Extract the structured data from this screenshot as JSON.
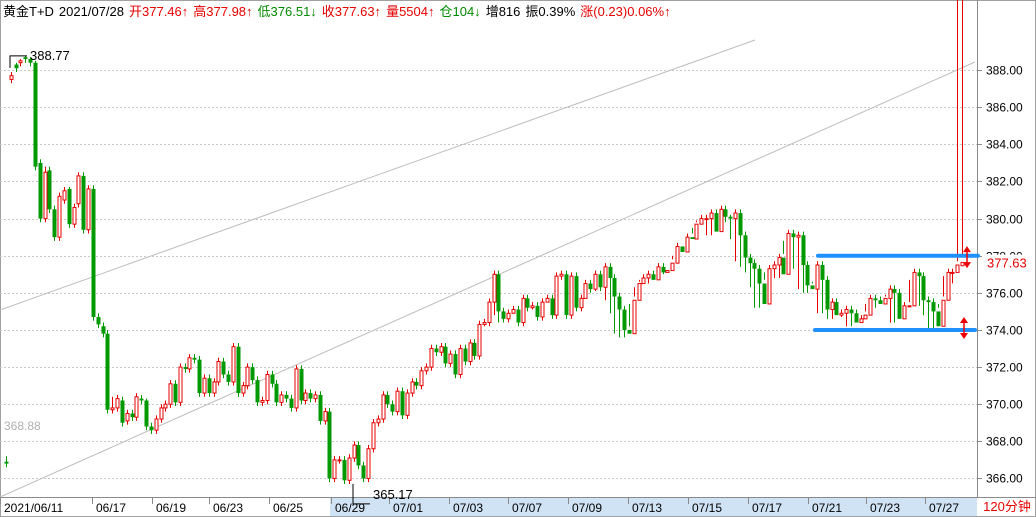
{
  "header": {
    "symbol": "黄金T+D",
    "date": "2021/07/28",
    "open": "开377.46↑",
    "high": "高377.98↑",
    "low": "低376.51↓",
    "close": "收377.63↑",
    "volume": "量5504↑",
    "position": "仓104↓",
    "increase": "增816",
    "amplitude": "振0.39%",
    "change": "涨(0.23)0.06%↑"
  },
  "timeframe": "120分钟",
  "colors": {
    "up": "#e60000",
    "down": "#009900",
    "support_lines": "#1e90ff",
    "arrows": "#ee0000"
  },
  "chart_data": {
    "type": "candlestick",
    "ylim": [
      365.0,
      390.0
    ],
    "y_ticks": [
      "366.00",
      "368.00",
      "370.00",
      "372.00",
      "374.00",
      "376.00",
      "378.00",
      "380.00",
      "382.00",
      "384.00",
      "386.00",
      "388.00"
    ],
    "x_labels": [
      "2021/06/11",
      "06/17",
      "06/19",
      "06/23",
      "06/25",
      "06/29",
      "07/01",
      "07/03",
      "07/07",
      "07/09",
      "07/13",
      "07/15",
      "07/17",
      "07/21",
      "07/23",
      "07/27"
    ],
    "annotations": {
      "high_label": "388.77",
      "low_label": "365.17",
      "left_ref": "368.88",
      "last_price": "377.63"
    },
    "range_lines": [
      378.0,
      374.0
    ],
    "closes": [
      366.8,
      387.7,
      388.1,
      388.5,
      388.6,
      388.4,
      382.8,
      380.0,
      382.5,
      380.5,
      379.0,
      381.2,
      381.5,
      379.7,
      380.6,
      382.3,
      379.4,
      381.6,
      374.7,
      374.3,
      373.8,
      369.7,
      369.8,
      370.3,
      369.0,
      369.5,
      369.3,
      370.4,
      370.2,
      368.8,
      368.6,
      369.2,
      369.8,
      370.0,
      371.1,
      370.1,
      372.0,
      371.9,
      372.5,
      372.4,
      370.6,
      371.4,
      370.6,
      371.2,
      372.3,
      371.6,
      371.2,
      373.1,
      370.6,
      371.0,
      372.0,
      371.3,
      370.1,
      370.2,
      371.6,
      371.1,
      370.1,
      370.5,
      370.3,
      369.8,
      371.9,
      370.2,
      370.6,
      370.3,
      370.5,
      369.1,
      369.6,
      366.0,
      367.0,
      367.0,
      365.9,
      367.1,
      367.8,
      366.7,
      366.0,
      367.6,
      369.0,
      369.2,
      370.5,
      370.0,
      369.6,
      370.7,
      369.4,
      370.6,
      371.2,
      371.0,
      371.8,
      372.0,
      373.0,
      372.8,
      373.1,
      372.2,
      372.7,
      371.6,
      373.0,
      372.3,
      373.3,
      372.6,
      374.3,
      374.4,
      375.5,
      377.0,
      375.0,
      374.6,
      374.9,
      375.1,
      374.4,
      375.7,
      375.2,
      375.3,
      374.7,
      375.5,
      375.7,
      374.8,
      376.9,
      377.0,
      374.8,
      376.9,
      375.2,
      375.7,
      376.5,
      376.2,
      377.0,
      376.3,
      377.4,
      376.8,
      375.8,
      375.1,
      374.0,
      373.8,
      375.6,
      376.5,
      376.8,
      377.0,
      376.7,
      377.4,
      377.1,
      377.2,
      377.6,
      378.5,
      378.2,
      379.0,
      378.9,
      379.7,
      380.0,
      380.0,
      380.3,
      379.3,
      380.5,
      380.1,
      380.0,
      380.3,
      379.1,
      377.9,
      377.6,
      377.3,
      376.5,
      375.4,
      377.3,
      377.5,
      377.9,
      377.0,
      379.2,
      379.0,
      379.1,
      377.5,
      376.4,
      376.2,
      377.5,
      376.7,
      375.1,
      375.5,
      374.8,
      374.9,
      375.1,
      374.9,
      374.4,
      374.6,
      374.8,
      375.7,
      375.6,
      375.4,
      375.7,
      376.2,
      376.0,
      374.6,
      375.3,
      375.3,
      377.1,
      376.9,
      375.6,
      375.5,
      375.0,
      374.2,
      375.6,
      377.1,
      377.1,
      377.5,
      377.63
    ],
    "opens": [
      366.9,
      387.5,
      388.3,
      388.4,
      388.7,
      388.6,
      388.4,
      383.0,
      380.0,
      382.6,
      380.5,
      379.0,
      381.0,
      381.6,
      379.7,
      380.8,
      382.3,
      379.4,
      381.6,
      374.7,
      374.2,
      373.8,
      369.7,
      369.8,
      370.2,
      369.1,
      369.5,
      369.3,
      370.3,
      370.2,
      368.8,
      368.6,
      369.2,
      369.8,
      370.0,
      371.1,
      370.1,
      372.0,
      371.9,
      372.5,
      372.4,
      370.6,
      371.4,
      370.6,
      371.2,
      372.3,
      371.6,
      371.2,
      373.1,
      370.6,
      371.0,
      372.0,
      371.3,
      370.1,
      370.2,
      371.6,
      371.1,
      370.1,
      370.5,
      370.3,
      369.8,
      371.9,
      370.2,
      370.6,
      370.3,
      370.5,
      369.1,
      369.6,
      366.0,
      367.0,
      367.0,
      365.9,
      367.1,
      367.8,
      366.7,
      366.0,
      367.6,
      369.0,
      369.2,
      370.5,
      370.0,
      369.6,
      370.7,
      369.4,
      370.6,
      371.2,
      371.0,
      371.8,
      372.0,
      373.0,
      372.8,
      373.1,
      372.2,
      372.7,
      371.6,
      373.0,
      372.3,
      373.3,
      372.6,
      374.3,
      374.4,
      375.5,
      377.0,
      375.0,
      374.6,
      374.9,
      375.1,
      374.4,
      375.7,
      375.2,
      375.3,
      374.7,
      375.5,
      375.7,
      374.8,
      376.9,
      377.0,
      374.8,
      376.9,
      375.2,
      375.7,
      376.5,
      376.2,
      377.0,
      376.3,
      377.4,
      376.8,
      375.8,
      375.1,
      374.0,
      373.8,
      375.6,
      376.5,
      376.8,
      377.0,
      376.7,
      377.4,
      377.1,
      377.2,
      377.6,
      378.5,
      378.2,
      379.0,
      378.9,
      379.7,
      380.0,
      380.0,
      380.3,
      379.3,
      380.5,
      380.1,
      380.0,
      380.3,
      379.1,
      377.9,
      377.6,
      377.3,
      376.5,
      375.4,
      377.3,
      377.5,
      377.9,
      377.0,
      379.2,
      379.0,
      379.1,
      377.5,
      376.4,
      376.2,
      377.5,
      376.7,
      375.1,
      375.5,
      374.8,
      374.9,
      375.1,
      374.9,
      374.4,
      374.6,
      374.8,
      375.7,
      375.6,
      375.4,
      375.7,
      376.2,
      376.0,
      374.6,
      375.3,
      375.3,
      377.1,
      376.9,
      375.6,
      375.5,
      375.0,
      374.2,
      375.6,
      377.1,
      377.1,
      377.46
    ],
    "highs": [
      367.2,
      387.9,
      388.4,
      388.6,
      388.77,
      388.7,
      388.5,
      383.2,
      382.8,
      382.8,
      380.7,
      381.4,
      381.7,
      381.7,
      380.8,
      382.5,
      382.5,
      381.8,
      381.8,
      374.9,
      374.4,
      374.0,
      370.4,
      370.5,
      370.4,
      369.7,
      369.7,
      370.6,
      370.5,
      370.3,
      369.0,
      369.4,
      370.0,
      370.2,
      371.3,
      371.3,
      372.2,
      372.2,
      372.7,
      372.7,
      372.6,
      371.6,
      371.6,
      371.4,
      372.5,
      372.5,
      371.8,
      373.3,
      373.3,
      371.2,
      372.2,
      372.2,
      371.5,
      370.4,
      371.8,
      371.8,
      371.3,
      370.7,
      370.7,
      370.5,
      372.1,
      372.1,
      370.8,
      370.8,
      370.7,
      370.7,
      369.8,
      369.8,
      367.2,
      367.2,
      367.2,
      367.3,
      368.0,
      368.0,
      366.9,
      367.8,
      369.2,
      369.4,
      370.7,
      370.7,
      370.2,
      370.9,
      370.9,
      370.8,
      371.4,
      371.4,
      372.0,
      372.2,
      373.2,
      373.2,
      373.3,
      373.3,
      372.9,
      372.9,
      373.2,
      373.2,
      373.5,
      373.5,
      374.5,
      374.6,
      375.7,
      377.2,
      377.2,
      375.2,
      375.1,
      375.3,
      375.3,
      375.9,
      375.9,
      375.5,
      375.5,
      375.7,
      375.9,
      375.9,
      377.1,
      377.2,
      377.2,
      377.1,
      377.1,
      375.9,
      376.7,
      376.7,
      377.2,
      377.2,
      377.6,
      377.6,
      377.0,
      376.0,
      375.3,
      374.2,
      375.8,
      376.7,
      377.0,
      377.2,
      377.2,
      377.6,
      377.6,
      377.4,
      377.8,
      378.7,
      378.7,
      379.2,
      379.2,
      379.9,
      380.2,
      380.2,
      380.5,
      380.5,
      380.7,
      380.7,
      380.2,
      380.5,
      380.5,
      379.3,
      378.1,
      377.8,
      377.5,
      376.7,
      377.5,
      377.7,
      378.1,
      378.1,
      379.4,
      379.4,
      379.3,
      379.3,
      377.7,
      376.6,
      377.7,
      377.7,
      376.9,
      375.7,
      375.7,
      375.1,
      375.3,
      375.3,
      375.1,
      374.8,
      375.0,
      375.9,
      375.9,
      375.8,
      375.9,
      376.4,
      376.4,
      376.2,
      375.5,
      375.5,
      377.3,
      377.3,
      377.1,
      375.8,
      375.7,
      375.2,
      375.8,
      377.3,
      377.3,
      377.7,
      377.98
    ],
    "lows": [
      366.6,
      387.3,
      387.9,
      388.2,
      388.4,
      388.2,
      382.6,
      379.8,
      379.8,
      380.3,
      378.8,
      378.8,
      380.8,
      379.5,
      379.5,
      380.6,
      379.2,
      379.2,
      374.5,
      374.1,
      373.6,
      369.5,
      369.5,
      369.6,
      368.8,
      368.9,
      369.1,
      369.1,
      370.0,
      368.6,
      368.4,
      368.4,
      369.0,
      369.6,
      369.8,
      369.9,
      369.9,
      371.7,
      371.7,
      372.2,
      370.4,
      370.4,
      370.4,
      370.4,
      371.0,
      371.4,
      371.0,
      371.0,
      370.4,
      370.4,
      370.8,
      371.1,
      369.9,
      369.9,
      370.0,
      370.9,
      369.9,
      369.9,
      370.1,
      369.6,
      369.6,
      370.0,
      370.0,
      370.1,
      370.1,
      368.9,
      368.9,
      365.8,
      365.8,
      366.8,
      365.7,
      365.7,
      366.9,
      366.5,
      365.8,
      365.8,
      367.4,
      368.8,
      369.0,
      369.8,
      369.4,
      369.4,
      369.2,
      369.2,
      370.4,
      370.8,
      370.8,
      371.6,
      371.8,
      372.6,
      372.6,
      372.0,
      372.0,
      371.4,
      371.4,
      372.1,
      372.1,
      372.4,
      372.4,
      374.2,
      374.2,
      374.8,
      374.4,
      374.4,
      374.4,
      374.9,
      374.2,
      374.2,
      375.0,
      375.1,
      374.5,
      374.5,
      375.5,
      374.6,
      374.6,
      376.7,
      374.6,
      374.6,
      375.0,
      375.0,
      376.0,
      376.0,
      376.1,
      376.1,
      375.6,
      374.9,
      373.8,
      373.6,
      373.6,
      375.4,
      376.3,
      376.6,
      376.5,
      376.5,
      376.9,
      376.9,
      377.0,
      377.4,
      378.0,
      378.0,
      378.7,
      378.7,
      379.5,
      379.8,
      379.8,
      379.1,
      379.1,
      379.9,
      379.8,
      379.8,
      378.9,
      377.7,
      377.4,
      377.1,
      376.3,
      375.2,
      375.2,
      377.1,
      377.3,
      376.8,
      376.8,
      378.8,
      378.8,
      377.3,
      376.2,
      376.0,
      376.0,
      376.5,
      374.9,
      374.9,
      374.6,
      374.6,
      374.9,
      374.7,
      374.2,
      374.2,
      374.4,
      374.6,
      375.4,
      375.2,
      375.2,
      375.5,
      375.8,
      374.4,
      374.4,
      375.1,
      375.1,
      376.7,
      375.4,
      375.3,
      374.8,
      374.0,
      374.0,
      375.4,
      376.9,
      376.9,
      376.51
    ]
  }
}
